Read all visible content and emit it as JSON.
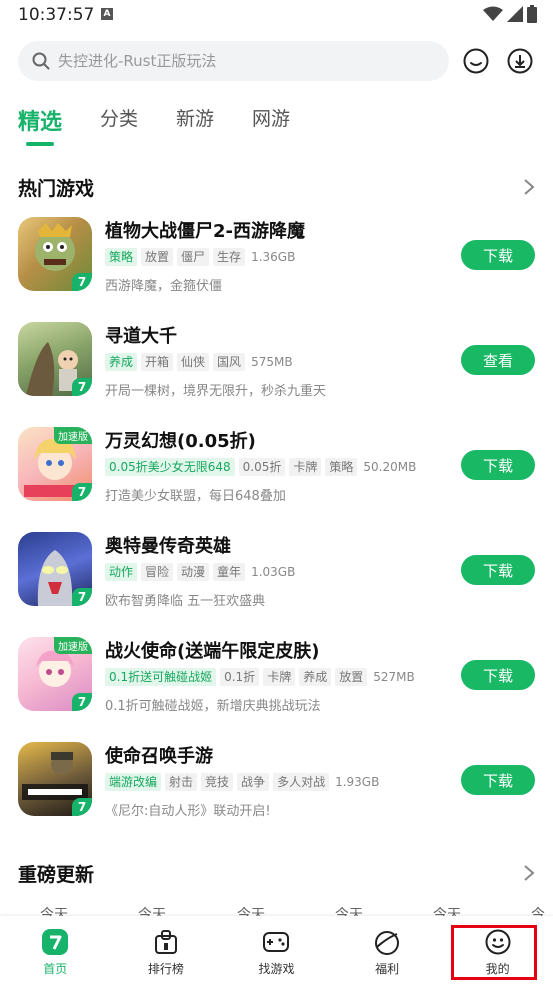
{
  "status": {
    "time": "10:37:57",
    "indicator": "A"
  },
  "search": {
    "placeholder": "失控进化-Rust正版玩法"
  },
  "tabs": [
    {
      "label": "精选",
      "active": true
    },
    {
      "label": "分类",
      "active": false
    },
    {
      "label": "新游",
      "active": false
    },
    {
      "label": "网游",
      "active": false
    }
  ],
  "sections": {
    "hot": {
      "title": "热门游戏"
    },
    "update": {
      "title": "重磅更新",
      "day_labels": [
        "今天",
        "今天",
        "今天",
        "今天",
        "今天",
        "今天"
      ]
    }
  },
  "games": [
    {
      "name": "植物大战僵尸2-西游降魔",
      "tags": [
        "策略",
        "放置",
        "僵尸",
        "生存"
      ],
      "size": "1.36GB",
      "desc": "西游降魔，金箍伏僵",
      "button": "下载",
      "speed_badge": ""
    },
    {
      "name": "寻道大千",
      "tags": [
        "养成",
        "开箱",
        "仙侠",
        "国风"
      ],
      "size": "575MB",
      "desc": "开局一棵树，境界无限升，秒杀九重天",
      "button": "查看",
      "speed_badge": ""
    },
    {
      "name": "万灵幻想(0.05折)",
      "tags": [
        "0.05折美少女无限648",
        "0.05折",
        "卡牌",
        "策略"
      ],
      "size": "50.20MB",
      "desc": "打造美少女联盟，每日648叠加",
      "button": "下载",
      "speed_badge": "加速版"
    },
    {
      "name": "奥特曼传奇英雄",
      "tags": [
        "动作",
        "冒险",
        "动漫",
        "童年"
      ],
      "size": "1.03GB",
      "desc": "欧布智勇降临 五一狂欢盛典",
      "button": "下载",
      "speed_badge": ""
    },
    {
      "name": "战火使命(送端午限定皮肤)",
      "tags": [
        "0.1折送可触碰战姬",
        "0.1折",
        "卡牌",
        "养成",
        "放置"
      ],
      "size": "527MB",
      "desc": "0.1折可触碰战姬，新增庆典挑战玩法",
      "button": "下载",
      "speed_badge": "加速版"
    },
    {
      "name": "使命召唤手游",
      "tags": [
        "端游改编",
        "射击",
        "竞技",
        "战争",
        "多人对战"
      ],
      "size": "1.93GB",
      "desc": "《尼尔:自动人形》联动开启!",
      "button": "下载",
      "speed_badge": ""
    }
  ],
  "nav": [
    {
      "label": "首页",
      "icon": "home-icon",
      "active": true
    },
    {
      "label": "排行榜",
      "icon": "ranking-icon",
      "active": false
    },
    {
      "label": "找游戏",
      "icon": "gamepad-icon",
      "active": false
    },
    {
      "label": "福利",
      "icon": "gift-icon",
      "active": false
    },
    {
      "label": "我的",
      "icon": "profile-icon",
      "active": false
    }
  ],
  "colors": {
    "accent": "#17b36a",
    "highlight": "#e60012"
  }
}
